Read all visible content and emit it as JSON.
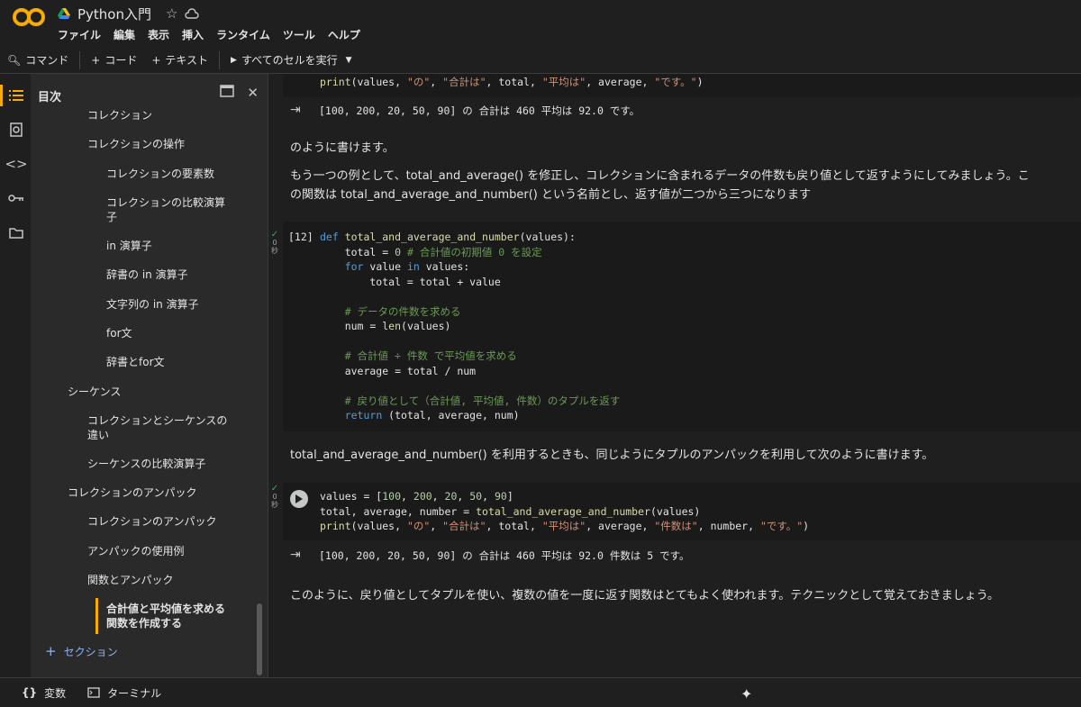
{
  "header": {
    "title": "Python入門",
    "menu": [
      "ファイル",
      "編集",
      "表示",
      "挿入",
      "ランタイム",
      "ツール",
      "ヘルプ"
    ]
  },
  "toolbar": {
    "command": "コマンド",
    "code": "コード",
    "text": "テキスト",
    "run_all": "すべてのセルを実行"
  },
  "toc": {
    "title": "目次",
    "items": [
      "コレクション",
      "コレクションの操作",
      "コレクションの要素数",
      "コレクションの比較演算\n子",
      "in 演算子",
      "辞書の in 演算子",
      "文字列の in 演算子",
      "for文",
      "辞書とfor文",
      "シーケンス",
      "コレクションとシーケンスの\n違い",
      "シーケンスの比較演算子",
      "コレクションのアンパック",
      "コレクションのアンパック",
      "アンパックの使用例",
      "関数とアンパック",
      "合計値と平均値を求める\n関数を作成する"
    ],
    "add_section": "セクション"
  },
  "cells": {
    "top_code": "print(values, \"の\", \"合計は\", total, \"平均は\", average, \"です。\")",
    "top_output": "[100, 200, 20, 50, 90] の 合計は 460 平均は 92.0 です。",
    "md1": "のように書けます。",
    "md2_line1": "もう一つの例として、total_and_average() を修正し、コレクションに含まれるデータの件数も戻り値として返すようにしてみましょう。こ",
    "md2_line2": "の関数は total_and_average_and_number() という名前とし、返す値が二つから三つになります",
    "cell12_count": "[12]",
    "exec_time": "0 秒",
    "md3": "total_and_average_and_number() を利用するときも、同じようにタプルのアンパックを利用して次のように書けます。",
    "bottom_output": "[100, 200, 20, 50, 90] の 合計は 460 平均は 92.0 件数は 5 です。",
    "md4": "このように、戻り値としてタプルを使い、複数の値を一度に返す関数はとてもよく使われます。テクニックとして覚えておきましょう。"
  },
  "statusbar": {
    "variables": "変数",
    "terminal": "ターミナル"
  },
  "colors": {
    "accent": "#f9ab00",
    "keyword": "#569cd6",
    "string": "#ce9178",
    "comment": "#6a9955"
  }
}
